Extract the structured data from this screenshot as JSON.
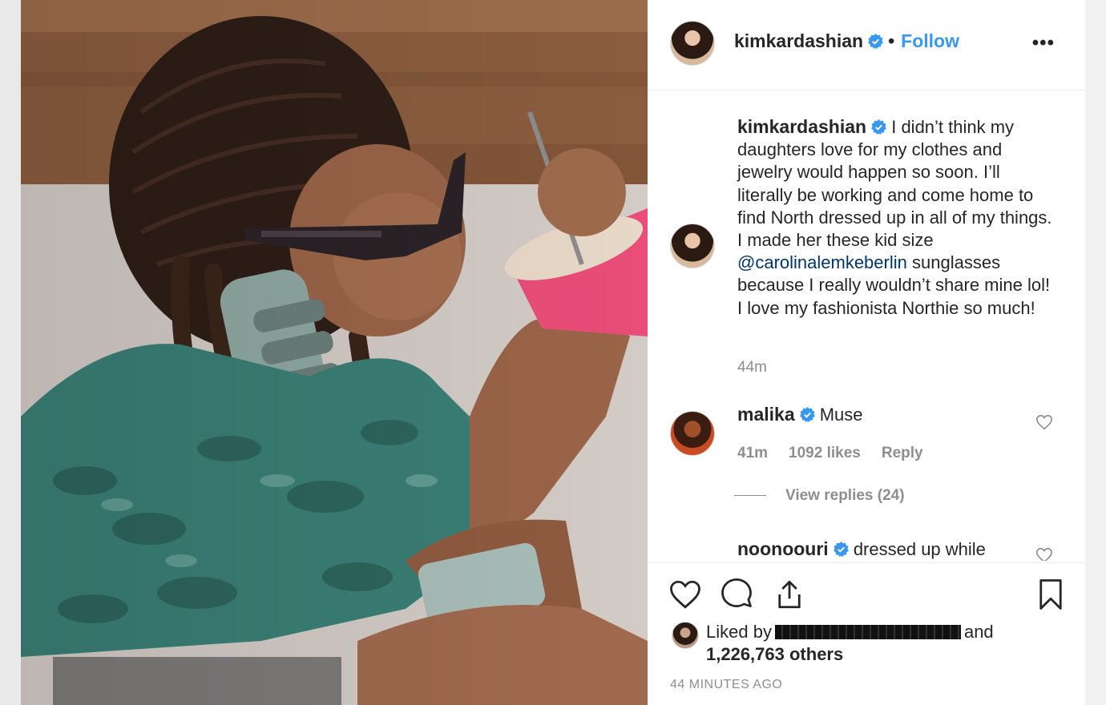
{
  "post": {
    "username": "kimkardashian",
    "separator": "•",
    "follow_label": "Follow",
    "more_label": "•••",
    "caption_pre": "I didn’t think my daughters love for my clothes and jewelry would happen so soon. I’ll literally be working and come home to find North dressed up in all of my things. I made her these kid size",
    "caption_mention": "@carolinalemkeberlin",
    "caption_post": "sunglasses because I really wouldn’t share mine lol! I love my fashionista Northie so much!",
    "caption_time": "44m"
  },
  "comments": [
    {
      "username": "malika",
      "text": "Muse",
      "time": "41m",
      "likes": "1092 likes",
      "reply_label": "Reply",
      "view_replies": "View replies (24)"
    },
    {
      "username": "noonoouri",
      "text": "dressed up while"
    }
  ],
  "likes": {
    "prefix": "Liked by",
    "suffix": "and",
    "count": "1,226,763 others"
  },
  "timestamp": "44 MINUTES AGO",
  "colors": {
    "follow_blue": "#3897f0",
    "verified_blue": "#3897f0",
    "mention": "#003569",
    "muted": "#8e8e8e"
  },
  "icons": [
    "verified-badge-icon",
    "more-options-icon",
    "heart-icon",
    "comment-icon",
    "share-icon",
    "bookmark-icon"
  ]
}
